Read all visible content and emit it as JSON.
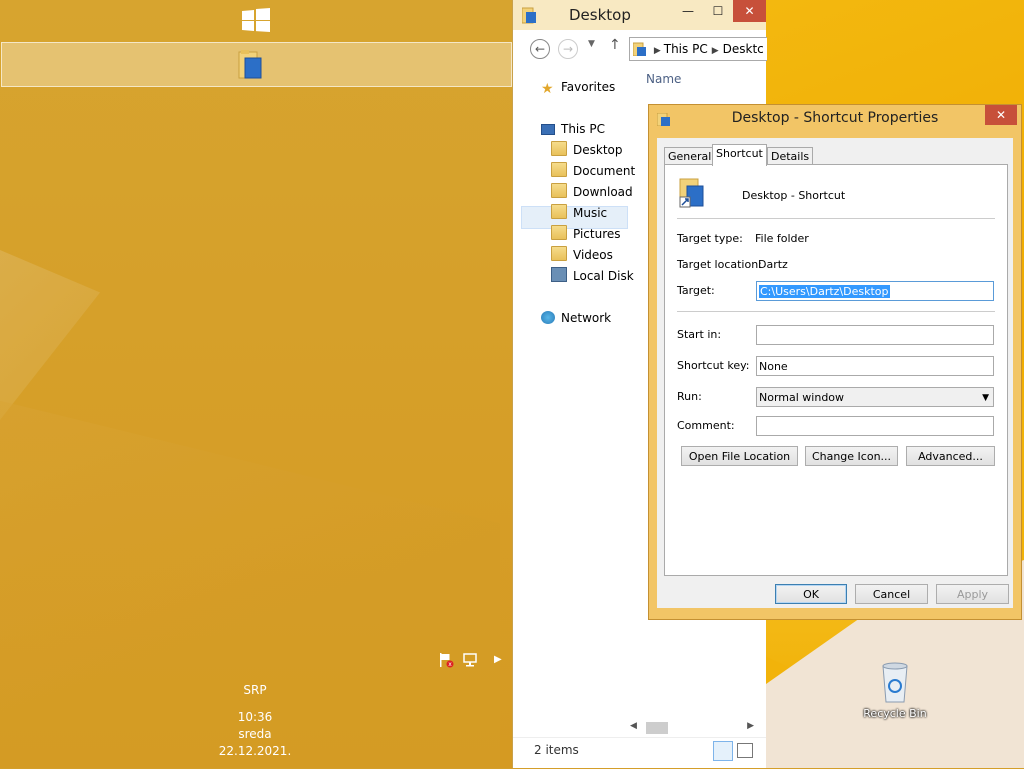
{
  "desktop": {
    "language_indicator": "SRP",
    "time": "10:36",
    "day": "sreda",
    "date": "22.12.2021.",
    "recycle_bin_label": "Recycle Bin"
  },
  "explorer": {
    "title": "Desktop",
    "address": [
      "This PC",
      "Desktc"
    ],
    "column_header": "Name",
    "nav": {
      "favorites": "Favorites",
      "this_pc": "This PC",
      "items": [
        "Desktop",
        "Document",
        "Download",
        "Music",
        "Pictures",
        "Videos",
        "Local Disk"
      ],
      "network": "Network"
    },
    "status": "2 items"
  },
  "dialog": {
    "title": "Desktop - Shortcut Properties",
    "close": "✕",
    "tabs": [
      "General",
      "Shortcut",
      "Details"
    ],
    "shortcut_name": "Desktop - Shortcut",
    "target_type_label": "Target type:",
    "target_type_value": "File folder",
    "target_location_label": "Target location:",
    "target_location_value": "Dartz",
    "target_label": "Target:",
    "target_value": "C:\\Users\\Dartz\\Desktop",
    "start_in_label": "Start in:",
    "start_in_value": "",
    "shortcut_key_label": "Shortcut key:",
    "shortcut_key_value": "None",
    "run_label": "Run:",
    "run_value": "Normal window",
    "comment_label": "Comment:",
    "comment_value": "",
    "open_location": "Open File Location",
    "change_icon": "Change Icon...",
    "advanced": "Advanced...",
    "ok": "OK",
    "cancel": "Cancel",
    "apply": "Apply"
  },
  "colors": {
    "desktop_bg": "#d49e2a",
    "accent_right": "#f0aa00",
    "dialog_frame": "#f2c566",
    "close_red": "#c7503a",
    "selection_blue": "#3399ff"
  }
}
